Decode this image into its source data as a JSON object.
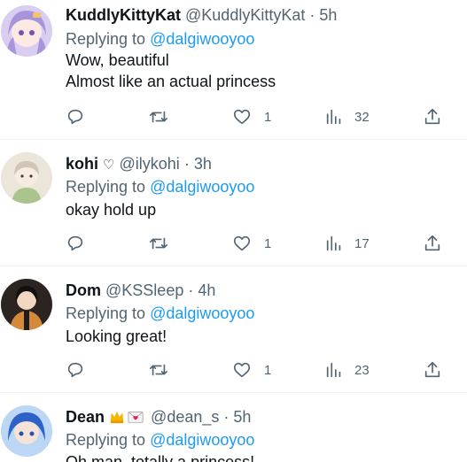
{
  "tweets": [
    {
      "name": "KuddlyKittyKat",
      "handle": "@KuddlyKittyKat",
      "dot": "·",
      "time": "5h",
      "replying_label": "Replying to",
      "replying_to": "@dalgiwooyoo",
      "text": "Wow, beautiful\nAlmost like an actual princess",
      "likes": "1",
      "views": "32",
      "avatar_color": "#c9b8ea"
    },
    {
      "name": "kohi",
      "name_symbol": "♡",
      "handle": "@ilykohi",
      "dot": "·",
      "time": "3h",
      "replying_label": "Replying to",
      "replying_to": "@dalgiwooyoo",
      "text": "okay hold up",
      "likes": "1",
      "views": "17",
      "avatar_color": "#e6ddd0"
    },
    {
      "name": "Dom",
      "handle": "@KSSleep",
      "dot": "·",
      "time": "4h",
      "replying_label": "Replying to",
      "replying_to": "@dalgiwooyoo",
      "text": "Looking great!",
      "likes": "1",
      "views": "23",
      "avatar_color": "#7a5a3a"
    },
    {
      "name": "Dean",
      "name_emojis": [
        "crown-icon",
        "love-letter-icon"
      ],
      "handle": "@dean_s",
      "dot": "·",
      "time": "5h",
      "replying_label": "Replying to",
      "replying_to": "@dalgiwooyoo",
      "text": "Oh man, totally a princess!",
      "avatar_color": "#3c6fd0"
    }
  ],
  "icons": {
    "reply": "reply-icon",
    "retweet": "retweet-icon",
    "like": "heart-icon",
    "views": "views-icon",
    "share": "share-icon"
  },
  "colors": {
    "link": "#1d9bf0",
    "secondary_text": "#536471",
    "primary_text": "#0f1419",
    "divider": "#eff3f4"
  }
}
